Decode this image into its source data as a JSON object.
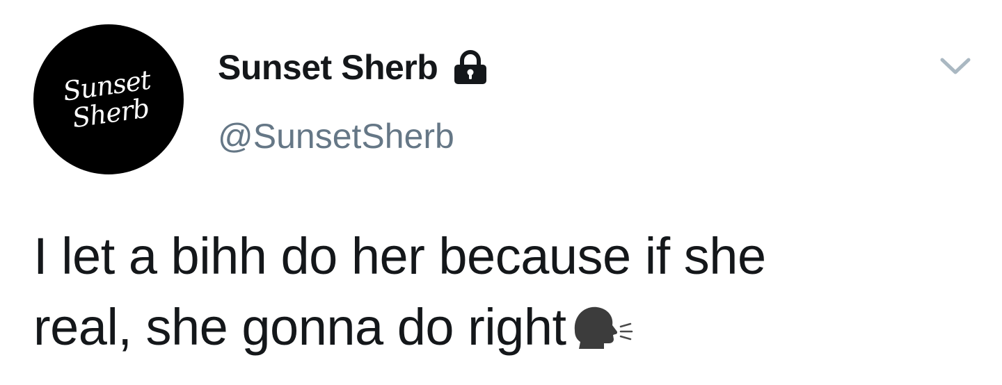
{
  "user": {
    "avatar_text_line1": "Sunset",
    "avatar_text_line2": "Sherb",
    "display_name": "Sunset Sherb",
    "handle": "@SunsetSherb",
    "protected_icon": "lock-icon"
  },
  "tweet": {
    "text_line1": "I let a bihh do her because if she",
    "text_line2": "real, she gonna do right",
    "emoji": "speaking-head-icon"
  },
  "menu": {
    "icon": "chevron-down-icon"
  },
  "colors": {
    "text_primary": "#14171a",
    "text_secondary": "#657786",
    "caret": "#aab8c2",
    "background": "#ffffff"
  }
}
